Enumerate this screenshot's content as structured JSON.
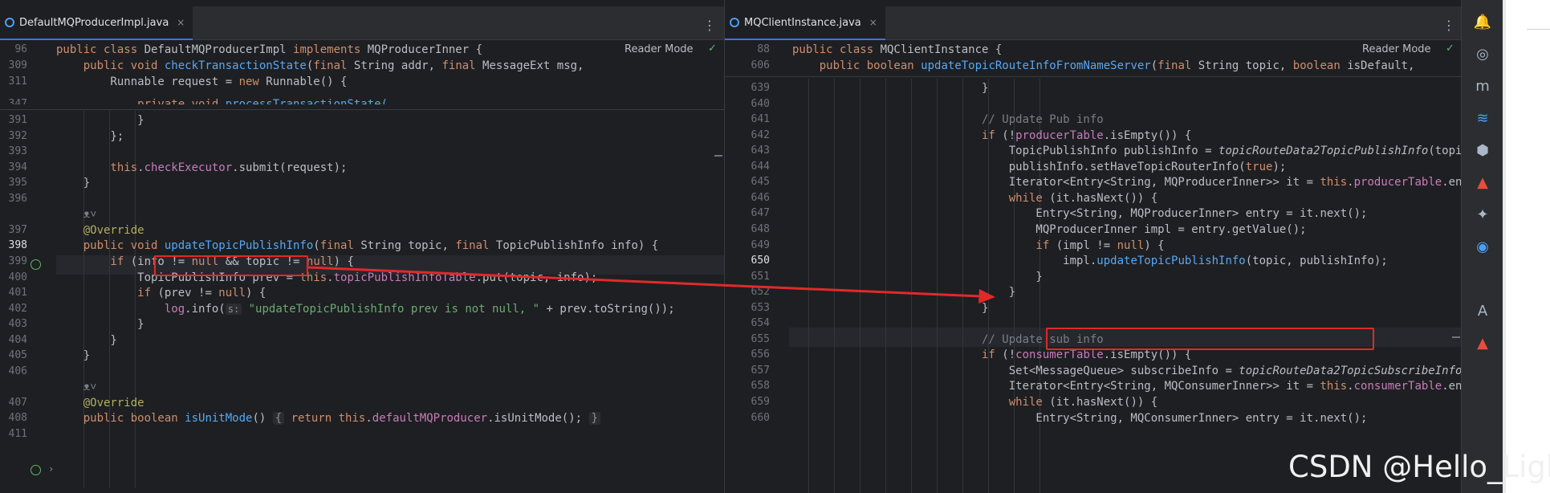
{
  "left_tab": {
    "label": "DefaultMQProducerImpl.java",
    "close": "×"
  },
  "right_tab": {
    "label": "MQClientInstance.java",
    "close": "×"
  },
  "more_glyph": "⋮",
  "reader_mode_label": "Reader Mode",
  "check_glyph": "✓",
  "watermark": "CSDN @Hello_Light",
  "icons": {
    "left_gutter_398": "override-implement-icon",
    "left_gutter_410": "override-implement-icon",
    "hint_glyph": "ᴥ˅"
  },
  "left_code": {
    "sticky": [
      {
        "num": "96",
        "tokens": [
          {
            "t": "public class ",
            "c": "kw"
          },
          {
            "t": "DefaultMQProducerImpl ",
            "c": ""
          },
          {
            "t": "implements ",
            "c": "kw"
          },
          {
            "t": "MQProducerInner {",
            "c": ""
          }
        ]
      },
      {
        "num": "309",
        "tokens": [
          {
            "t": "    public void ",
            "c": "kw"
          },
          {
            "t": "checkTransactionState",
            "c": "fn"
          },
          {
            "t": "(",
            "c": ""
          },
          {
            "t": "final ",
            "c": "kw"
          },
          {
            "t": "String addr, ",
            "c": ""
          },
          {
            "t": "final ",
            "c": "kw"
          },
          {
            "t": "MessageExt msg,",
            "c": ""
          }
        ]
      },
      {
        "num": "311",
        "tokens": [
          {
            "t": "        Runnable request = ",
            "c": ""
          },
          {
            "t": "new ",
            "c": "kw"
          },
          {
            "t": "Runnable() {",
            "c": ""
          }
        ]
      },
      {
        "num": "347",
        "tokens": [
          {
            "t": "            private void ",
            "c": "kw"
          },
          {
            "t": "processTransactionState(",
            "c": "fn"
          }
        ]
      }
    ],
    "lines": [
      {
        "num": "391",
        "tokens": [
          {
            "t": "            }",
            "c": ""
          }
        ]
      },
      {
        "num": "392",
        "tokens": [
          {
            "t": "        };",
            "c": ""
          }
        ]
      },
      {
        "num": "393",
        "tokens": []
      },
      {
        "num": "394",
        "tokens": [
          {
            "t": "        ",
            "c": ""
          },
          {
            "t": "this",
            "c": "kw"
          },
          {
            "t": ".",
            "c": ""
          },
          {
            "t": "checkExecutor",
            "c": "fld"
          },
          {
            "t": ".submit(request);",
            "c": ""
          }
        ]
      },
      {
        "num": "395",
        "tokens": [
          {
            "t": "    }",
            "c": ""
          }
        ]
      },
      {
        "num": "396",
        "tokens": []
      },
      {
        "num": "",
        "tokens": [
          {
            "t": "    ᴥ˅",
            "c": "cmt"
          }
        ]
      },
      {
        "num": "397",
        "tokens": [
          {
            "t": "    @Override",
            "c": "ann"
          }
        ]
      },
      {
        "num": "398",
        "tokens": [
          {
            "t": "    public void ",
            "c": "kw"
          },
          {
            "t": "updateTopicPublishInfo",
            "c": "fn"
          },
          {
            "t": "(",
            "c": ""
          },
          {
            "t": "final ",
            "c": "kw"
          },
          {
            "t": "String topic, ",
            "c": ""
          },
          {
            "t": "final ",
            "c": "kw"
          },
          {
            "t": "TopicPublishInfo info) {",
            "c": ""
          }
        ]
      },
      {
        "num": "399",
        "tokens": [
          {
            "t": "        if ",
            "c": "kw"
          },
          {
            "t": "(info != ",
            "c": ""
          },
          {
            "t": "null ",
            "c": "kw"
          },
          {
            "t": "&& topic != ",
            "c": ""
          },
          {
            "t": "null",
            "c": "kw"
          },
          {
            "t": ") {",
            "c": ""
          }
        ]
      },
      {
        "num": "400",
        "tokens": [
          {
            "t": "            TopicPublishInfo prev = ",
            "c": ""
          },
          {
            "t": "this",
            "c": "kw"
          },
          {
            "t": ".",
            "c": ""
          },
          {
            "t": "topicPublishInfoTable",
            "c": "fld"
          },
          {
            "t": ".put(topic, info);",
            "c": ""
          }
        ]
      },
      {
        "num": "401",
        "tokens": [
          {
            "t": "            if ",
            "c": "kw"
          },
          {
            "t": "(prev != ",
            "c": ""
          },
          {
            "t": "null",
            "c": "kw"
          },
          {
            "t": ") {",
            "c": ""
          }
        ]
      },
      {
        "num": "402",
        "tokens": [
          {
            "t": "                ",
            "c": ""
          },
          {
            "t": "log",
            "c": "fld"
          },
          {
            "t": ".info(",
            "c": ""
          },
          {
            "t": "s:",
            "c": "hint"
          },
          {
            "t": " ",
            "c": ""
          },
          {
            "t": "\"updateTopicPublishInfo prev is not null, \"",
            "c": "str"
          },
          {
            "t": " + prev.toString());",
            "c": ""
          }
        ]
      },
      {
        "num": "403",
        "tokens": [
          {
            "t": "            }",
            "c": ""
          }
        ]
      },
      {
        "num": "404",
        "tokens": [
          {
            "t": "        }",
            "c": ""
          }
        ]
      },
      {
        "num": "405",
        "tokens": [
          {
            "t": "    }",
            "c": ""
          }
        ]
      },
      {
        "num": "406",
        "tokens": []
      },
      {
        "num": "",
        "tokens": [
          {
            "t": "    ᴥ˅",
            "c": "cmt"
          }
        ]
      },
      {
        "num": "407",
        "tokens": [
          {
            "t": "    @Override",
            "c": "ann"
          }
        ]
      },
      {
        "num": "408",
        "tokens": [
          {
            "t": "    public boolean ",
            "c": "kw"
          },
          {
            "t": "isUnitMode",
            "c": "fn"
          },
          {
            "t": "() ",
            "c": ""
          },
          {
            "t": "{",
            "c": "fold"
          },
          {
            "t": " ",
            "c": ""
          },
          {
            "t": "return this",
            "c": "kw"
          },
          {
            "t": ".",
            "c": ""
          },
          {
            "t": "defaultMQProducer",
            "c": "fld"
          },
          {
            "t": ".isUnitMode(); ",
            "c": ""
          },
          {
            "t": "}",
            "c": "fold"
          }
        ]
      },
      {
        "num": "411",
        "tokens": []
      }
    ]
  },
  "right_code": {
    "sticky": [
      {
        "num": "88",
        "tokens": [
          {
            "t": "public class ",
            "c": "kw"
          },
          {
            "t": "MQClientInstance {",
            "c": ""
          }
        ]
      },
      {
        "num": "606",
        "tokens": [
          {
            "t": "    public boolean ",
            "c": "kw"
          },
          {
            "t": "updateTopicRouteInfoFromNameServer",
            "c": "fn"
          },
          {
            "t": "(",
            "c": ""
          },
          {
            "t": "final ",
            "c": "kw"
          },
          {
            "t": "String topic, ",
            "c": ""
          },
          {
            "t": "boolean ",
            "c": "kw"
          },
          {
            "t": "isDefault,",
            "c": ""
          }
        ]
      }
    ],
    "lines": [
      {
        "num": "639",
        "tokens": [
          {
            "t": "                            }",
            "c": ""
          }
        ]
      },
      {
        "num": "640",
        "tokens": []
      },
      {
        "num": "641",
        "tokens": [
          {
            "t": "                            // Update Pub info",
            "c": "cmt"
          }
        ]
      },
      {
        "num": "642",
        "tokens": [
          {
            "t": "                            if ",
            "c": "kw"
          },
          {
            "t": "(!",
            "c": ""
          },
          {
            "t": "producerTable",
            "c": "fld"
          },
          {
            "t": ".isEmpty()) {",
            "c": ""
          }
        ]
      },
      {
        "num": "643",
        "tokens": [
          {
            "t": "                                TopicPublishInfo publishInfo = ",
            "c": ""
          },
          {
            "t": "topicRouteData2TopicPublishInfo",
            "c": "it"
          },
          {
            "t": "(topic, to",
            "c": ""
          }
        ]
      },
      {
        "num": "644",
        "tokens": [
          {
            "t": "                                publishInfo.setHaveTopicRouterInfo(",
            "c": ""
          },
          {
            "t": "true",
            "c": "kw"
          },
          {
            "t": ");",
            "c": ""
          }
        ]
      },
      {
        "num": "645",
        "tokens": [
          {
            "t": "                                Iterator<Entry<String, MQProducerInner>> it = ",
            "c": ""
          },
          {
            "t": "this",
            "c": "kw"
          },
          {
            "t": ".",
            "c": ""
          },
          {
            "t": "producerTable",
            "c": "fld"
          },
          {
            "t": ".entrySe",
            "c": ""
          }
        ]
      },
      {
        "num": "646",
        "tokens": [
          {
            "t": "                                while ",
            "c": "kw"
          },
          {
            "t": "(it.hasNext()) {",
            "c": ""
          }
        ]
      },
      {
        "num": "647",
        "tokens": [
          {
            "t": "                                    Entry<String, MQProducerInner> entry = it.next();",
            "c": ""
          }
        ]
      },
      {
        "num": "648",
        "tokens": [
          {
            "t": "                                    MQProducerInner impl = entry.getValue();",
            "c": ""
          }
        ]
      },
      {
        "num": "649",
        "tokens": [
          {
            "t": "                                    if ",
            "c": "kw"
          },
          {
            "t": "(impl != ",
            "c": ""
          },
          {
            "t": "null",
            "c": "kw"
          },
          {
            "t": ") {",
            "c": ""
          }
        ]
      },
      {
        "num": "650",
        "tokens": [
          {
            "t": "                                        impl.",
            "c": ""
          },
          {
            "t": "updateTopicPublishInfo",
            "c": "fn"
          },
          {
            "t": "(topic, publishInfo);",
            "c": ""
          }
        ]
      },
      {
        "num": "651",
        "tokens": [
          {
            "t": "                                    }",
            "c": ""
          }
        ]
      },
      {
        "num": "652",
        "tokens": [
          {
            "t": "                                }",
            "c": ""
          }
        ]
      },
      {
        "num": "653",
        "tokens": [
          {
            "t": "                            }",
            "c": ""
          }
        ]
      },
      {
        "num": "654",
        "tokens": []
      },
      {
        "num": "655",
        "tokens": [
          {
            "t": "                            // Update sub info",
            "c": "cmt"
          }
        ]
      },
      {
        "num": "656",
        "tokens": [
          {
            "t": "                            if ",
            "c": "kw"
          },
          {
            "t": "(!",
            "c": ""
          },
          {
            "t": "consumerTable",
            "c": "fld"
          },
          {
            "t": ".isEmpty()) {",
            "c": ""
          }
        ]
      },
      {
        "num": "657",
        "tokens": [
          {
            "t": "                                Set<MessageQueue> subscribeInfo = ",
            "c": ""
          },
          {
            "t": "topicRouteData2TopicSubscribeInfo",
            "c": "it"
          },
          {
            "t": "(topi",
            "c": ""
          }
        ]
      },
      {
        "num": "658",
        "tokens": [
          {
            "t": "                                Iterator<Entry<String, MQConsumerInner>> it = ",
            "c": ""
          },
          {
            "t": "this",
            "c": "kw"
          },
          {
            "t": ".",
            "c": ""
          },
          {
            "t": "consumerTable",
            "c": "fld"
          },
          {
            "t": ".entrySe",
            "c": ""
          }
        ]
      },
      {
        "num": "659",
        "tokens": [
          {
            "t": "                                while ",
            "c": "kw"
          },
          {
            "t": "(it.hasNext()) {",
            "c": ""
          }
        ]
      },
      {
        "num": "660",
        "tokens": [
          {
            "t": "                                    Entry<String, MQConsumerInner> entry = it.next();",
            "c": ""
          }
        ]
      }
    ]
  },
  "sidebar_icons": [
    "notifications-icon",
    "ai-assistant-icon",
    "maven-icon",
    "database-icon",
    "plugin-icon",
    "gradle-icon",
    "tool-icon",
    "copilot-icon",
    "translate-icon",
    "gradle-alt-icon"
  ],
  "sidebar_glyphs": [
    "🔔",
    "◎",
    "m",
    "≋",
    "⬢",
    "▲",
    "✦",
    "◉",
    "A",
    "▲"
  ]
}
